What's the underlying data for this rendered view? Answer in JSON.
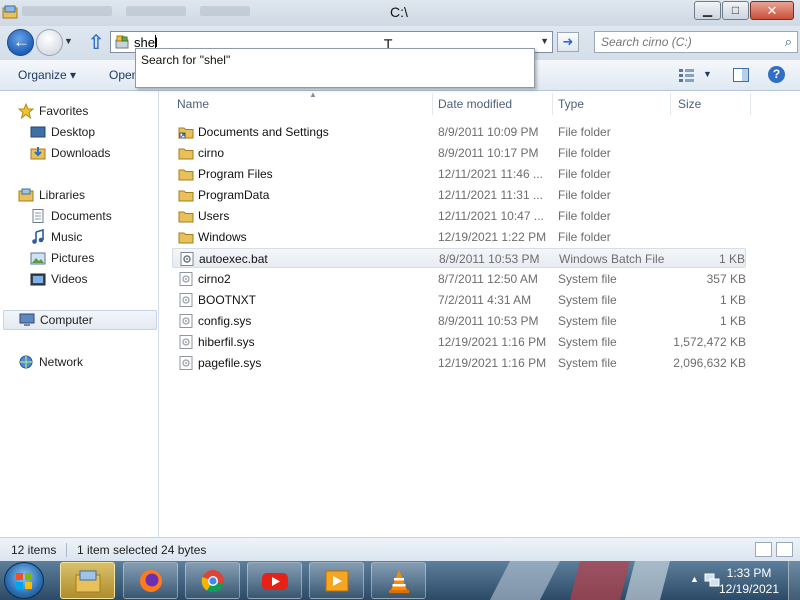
{
  "window": {
    "title": "C:\\",
    "controls": {
      "minimize": "▁",
      "maximize": "□",
      "close": "✕"
    }
  },
  "address_bar": {
    "value": "shel",
    "go_glyph": "➜",
    "search_placeholder": "Search cirno (C:)"
  },
  "autocomplete": {
    "item": "Search for \"shel\""
  },
  "toolbar": {
    "organize": "Organize ▾",
    "open": "Open",
    "help": "?"
  },
  "sidebar": {
    "favorites": "Favorites",
    "favorites_items": [
      "Desktop",
      "Downloads"
    ],
    "libraries": "Libraries",
    "libraries_items": [
      "Documents",
      "Music",
      "Pictures",
      "Videos"
    ],
    "computer": "Computer",
    "network": "Network"
  },
  "columns": {
    "name": "Name",
    "date": "Date modified",
    "type": "Type",
    "size": "Size"
  },
  "files": [
    {
      "name": "Documents and Settings",
      "date": "8/9/2011 10:09 PM",
      "type": "File folder",
      "size": "",
      "icon": "folder-shortcut-icon"
    },
    {
      "name": "cirno",
      "date": "8/9/2011 10:17 PM",
      "type": "File folder",
      "size": "",
      "icon": "folder-icon"
    },
    {
      "name": "Program Files",
      "date": "12/11/2021 11:46 ...",
      "type": "File folder",
      "size": "",
      "icon": "folder-icon"
    },
    {
      "name": "ProgramData",
      "date": "12/11/2021 11:31 ...",
      "type": "File folder",
      "size": "",
      "icon": "folder-icon"
    },
    {
      "name": "Users",
      "date": "12/11/2021 10:47 ...",
      "type": "File folder",
      "size": "",
      "icon": "folder-icon"
    },
    {
      "name": "Windows",
      "date": "12/19/2021 1:22 PM",
      "type": "File folder",
      "size": "",
      "icon": "folder-icon"
    },
    {
      "name": "autoexec.bat",
      "date": "8/9/2011 10:53 PM",
      "type": "Windows Batch File",
      "size": "1 KB",
      "icon": "batch-file-icon"
    },
    {
      "name": "cirno2",
      "date": "8/7/2011 12:50 AM",
      "type": "System file",
      "size": "357 KB",
      "icon": "system-file-icon"
    },
    {
      "name": "BOOTNXT",
      "date": "7/2/2011 4:31 AM",
      "type": "System file",
      "size": "1 KB",
      "icon": "system-file-icon"
    },
    {
      "name": "config.sys",
      "date": "8/9/2011 10:53 PM",
      "type": "System file",
      "size": "1 KB",
      "icon": "system-file-icon"
    },
    {
      "name": "hiberfil.sys",
      "date": "12/19/2021 1:16 PM",
      "type": "System file",
      "size": "1,572,472 KB",
      "icon": "system-file-icon"
    },
    {
      "name": "pagefile.sys",
      "date": "12/19/2021 1:16 PM",
      "type": "System file",
      "size": "2,096,632 KB",
      "icon": "system-file-icon"
    }
  ],
  "status": {
    "count": "12 items",
    "selection": "1 item selected  24 bytes"
  },
  "taskbar": {
    "apps": [
      "file-explorer",
      "firefox",
      "chrome",
      "youtube",
      "media-player",
      "vlc"
    ],
    "time": "1:33 PM",
    "date": "12/19/2021"
  },
  "colors": {
    "accent": "#2a6fc6",
    "taskbar": "#2c4a66",
    "folder": "#e8c15a"
  }
}
